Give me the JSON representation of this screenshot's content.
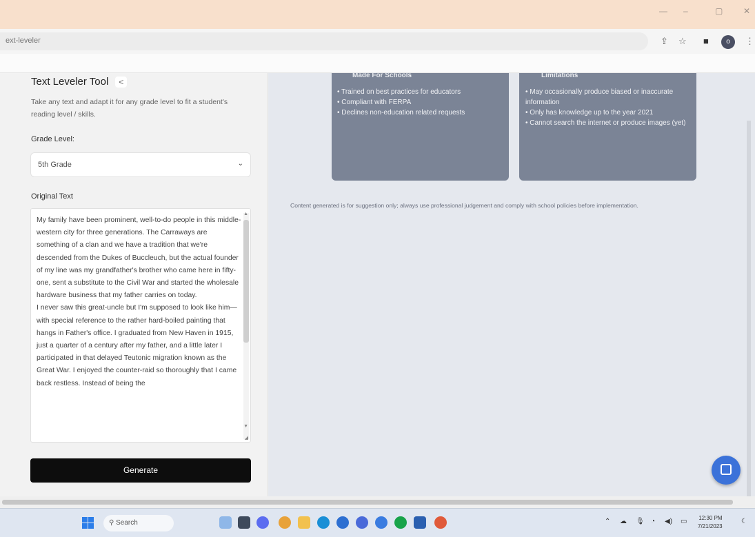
{
  "browser": {
    "url": "ext-leveler",
    "window_controls": [
      "—",
      "–",
      "▢",
      "✕"
    ]
  },
  "tool": {
    "title": "Text Leveler Tool",
    "description": "Take any text and adapt it for any grade level to fit a student's reading level / skills.",
    "grade_label": "Grade Level:",
    "grade_value": "5th Grade",
    "original_label": "Original Text",
    "original_text": "My family have been prominent, well-to-do people in this middle-western city for three generations. The Carraways are something of a clan and we have a tradition that we're descended from the Dukes of Buccleuch, but the actual founder of my line was my grandfather's brother who came here in fifty-one, sent a substitute to the Civil War and started the wholesale hardware business that my father carries on today.\nI never saw this great-uncle but I'm supposed to look like him—with special reference to the rather hard-boiled painting that hangs in Father's office. I graduated from New Haven in 1915, just a quarter of a century after my father, and a little later I participated in that delayed Teutonic migration known as the Great War. I enjoyed the counter-raid so thoroughly that I came back restless. Instead of being the",
    "generate_label": "Generate"
  },
  "cards": [
    {
      "heading": "Made For Schools",
      "items": [
        "Trained on best practices for educators",
        "Compliant with FERPA",
        "Declines non-education related requests"
      ]
    },
    {
      "heading": "Limitations",
      "items": [
        "May occasionally produce biased or inaccurate information",
        "Only has knowledge up to the year 2021",
        "Cannot search the internet or produce images (yet)"
      ]
    }
  ],
  "disclaimer": "Content generated is for suggestion only; always use professional judgement and comply with school policies before implementation.",
  "taskbar": {
    "search_label": "Search",
    "time": "12:30 PM",
    "date": "7/21/2023"
  },
  "colors": {
    "titlebar": "#f8e0cc",
    "card": "#7b8496",
    "right_bg": "#e5e8ee",
    "generate": "#0d0d0d",
    "chat": "#3b72d9"
  }
}
